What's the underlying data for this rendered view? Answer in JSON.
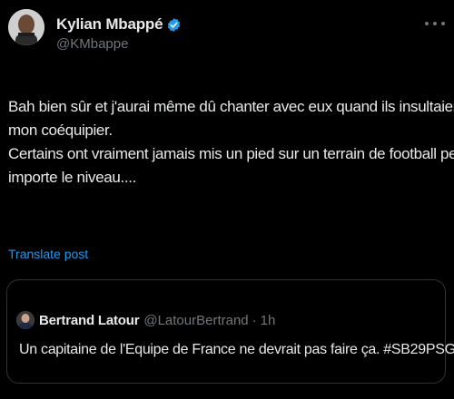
{
  "theme": {
    "background": "#000000",
    "text_primary": "#e7e9ea",
    "text_secondary": "#71767b",
    "accent": "#1d9bf0",
    "border": "#2f3336"
  },
  "author": {
    "display_name": "Kylian Mbappé",
    "handle": "@KMbappe",
    "verified_icon": "verified-badge-icon",
    "avatar_icon": "profile-avatar"
  },
  "post": {
    "lines": [
      "Bah bien sûr et j'aurai même dû chanter avec eux quand ils insultaient",
      "mon coéquipier.",
      "Certains ont vraiment jamais mis un pied sur un terrain de football peu",
      "importe le niveau...."
    ],
    "translate_label": "Translate post"
  },
  "quoted_post": {
    "display_name": "Bertrand Latour",
    "handle": "@LatourBertrand",
    "separator": "·",
    "time": "1h",
    "text": "Un capitaine de l'Equipe de France ne devrait pas faire ça. #SB29PSG"
  }
}
